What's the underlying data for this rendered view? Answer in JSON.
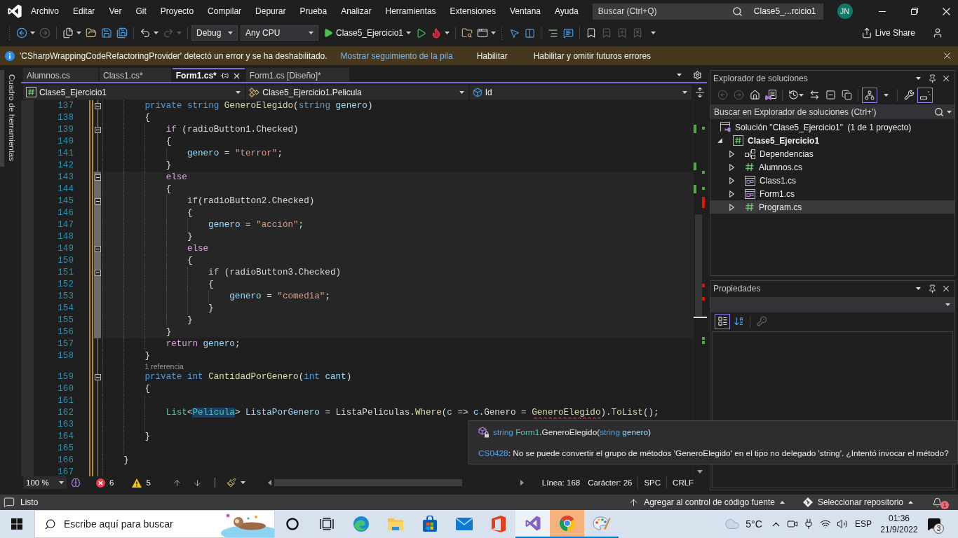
{
  "menu_bar": {
    "items": [
      "Archivo",
      "Editar",
      "Ver",
      "Git",
      "Proyecto",
      "Compilar",
      "Depurar",
      "Prueba",
      "Analizar",
      "Herramientas",
      "Extensiones",
      "Ventana",
      "Ayuda"
    ],
    "search": {
      "placeholder": "Buscar (Ctrl+Q)"
    },
    "solution_name": "Clase5_...rcicio1",
    "account_initials": "JN"
  },
  "toolbar": {
    "navigation": [
      {
        "disabled": false
      },
      {
        "disabled": true
      }
    ],
    "history": [
      {
        "disabled": false
      },
      {
        "disabled": true
      }
    ],
    "configuration": "Debug",
    "platform": "Any CPU",
    "startup_project": "Clase5_Ejercicio1",
    "bookmarks": [
      {
        "disabled": false
      },
      {
        "disabled": true
      },
      {
        "disabled": true
      },
      {
        "disabled": true
      }
    ],
    "live_share": "Live Share"
  },
  "info_bar": {
    "message": "'CSharpWrappingCodeRefactoringProvider' detectó un error y se ha deshabilitado.",
    "link": "Mostrar seguimiento de la pila",
    "actions": [
      "Habilitar",
      "Habilitar y omitir futuros errores"
    ]
  },
  "side_tabs": [
    "Cuadro de herramientas"
  ],
  "editor": {
    "tabs": [
      {
        "label": "Alumnos.cs",
        "selected": false
      },
      {
        "label": "Class1.cs*",
        "selected": false
      },
      {
        "label": "Form1.cs*",
        "selected": true
      },
      {
        "label": "Form1.cs [Diseño]*",
        "selected": false
      }
    ],
    "navigation": [
      "Clase5_Ejercicio1",
      "Clase5_Ejercicio1.Pelicula",
      "Id"
    ],
    "lines": [
      {
        "kind": "code",
        "number": "137",
        "foldable": true,
        "highlighted": false,
        "modified": true,
        "tokens": [
          {
            "text": "        private string ",
            "kind": "keyword"
          },
          {
            "text": "GeneroElegido",
            "kind": "method"
          },
          {
            "text": "(",
            "kind": "plain"
          },
          {
            "text": "string ",
            "kind": "keyword"
          },
          {
            "text": "genero",
            "kind": "variable"
          },
          {
            "text": ")",
            "kind": "plain"
          }
        ]
      },
      {
        "kind": "code",
        "number": "138",
        "foldable": false,
        "highlighted": false,
        "modified": true,
        "tokens": [
          {
            "text": "        {",
            "kind": "plain"
          }
        ]
      },
      {
        "kind": "code",
        "number": "139",
        "foldable": true,
        "highlighted": false,
        "modified": true,
        "tokens": [
          {
            "text": "            if",
            "kind": "control"
          },
          {
            "text": " (radioButton1.Checked)",
            "kind": "plain"
          }
        ]
      },
      {
        "kind": "code",
        "number": "140",
        "foldable": false,
        "highlighted": false,
        "modified": true,
        "tokens": [
          {
            "text": "            {",
            "kind": "plain"
          }
        ]
      },
      {
        "kind": "code",
        "number": "141",
        "foldable": false,
        "highlighted": false,
        "modified": true,
        "tokens": [
          {
            "text": "                genero",
            "kind": "variable"
          },
          {
            "text": " = ",
            "kind": "plain"
          },
          {
            "text": "\"terror\"",
            "kind": "string"
          },
          {
            "text": ";",
            "kind": "plain"
          }
        ]
      },
      {
        "kind": "code",
        "number": "142",
        "foldable": false,
        "highlighted": false,
        "modified": true,
        "tokens": [
          {
            "text": "            }",
            "kind": "plain"
          }
        ]
      },
      {
        "kind": "code",
        "number": "143",
        "foldable": true,
        "highlighted": true,
        "modified": true,
        "tokens": [
          {
            "text": "            else",
            "kind": "control"
          }
        ]
      },
      {
        "kind": "code",
        "number": "144",
        "foldable": false,
        "highlighted": true,
        "modified": true,
        "tokens": [
          {
            "text": "            {",
            "kind": "plain"
          }
        ]
      },
      {
        "kind": "code",
        "number": "145",
        "foldable": true,
        "highlighted": true,
        "modified": true,
        "tokens": [
          {
            "text": "                if",
            "kind": "control"
          },
          {
            "text": "(radioButton2.Checked)",
            "kind": "plain"
          }
        ]
      },
      {
        "kind": "code",
        "number": "146",
        "foldable": false,
        "highlighted": true,
        "modified": true,
        "tokens": [
          {
            "text": "                {",
            "kind": "plain"
          }
        ]
      },
      {
        "kind": "code",
        "number": "147",
        "foldable": false,
        "highlighted": true,
        "modified": true,
        "tokens": [
          {
            "text": "                    genero",
            "kind": "variable"
          },
          {
            "text": " = ",
            "kind": "plain"
          },
          {
            "text": "\"acción\"",
            "kind": "string"
          },
          {
            "text": ";",
            "kind": "plain"
          }
        ]
      },
      {
        "kind": "code",
        "number": "148",
        "foldable": false,
        "highlighted": true,
        "modified": true,
        "tokens": [
          {
            "text": "                }",
            "kind": "plain"
          }
        ]
      },
      {
        "kind": "code",
        "number": "149",
        "foldable": true,
        "highlighted": true,
        "modified": true,
        "tokens": [
          {
            "text": "                else",
            "kind": "control"
          }
        ]
      },
      {
        "kind": "code",
        "number": "150",
        "foldable": false,
        "highlighted": true,
        "modified": true,
        "tokens": [
          {
            "text": "                {",
            "kind": "plain"
          }
        ]
      },
      {
        "kind": "code",
        "number": "151",
        "foldable": true,
        "highlighted": true,
        "modified": true,
        "tokens": [
          {
            "text": "                    if",
            "kind": "control"
          },
          {
            "text": " (radioButton3.Checked)",
            "kind": "plain"
          }
        ]
      },
      {
        "kind": "code",
        "number": "152",
        "foldable": false,
        "highlighted": true,
        "modified": true,
        "tokens": [
          {
            "text": "                    {",
            "kind": "plain"
          }
        ]
      },
      {
        "kind": "code",
        "number": "153",
        "foldable": false,
        "highlighted": true,
        "modified": true,
        "tokens": [
          {
            "text": "                        genero",
            "kind": "variable"
          },
          {
            "text": " = ",
            "kind": "plain"
          },
          {
            "text": "\"comedia\"",
            "kind": "string"
          },
          {
            "text": ";",
            "kind": "plain"
          }
        ]
      },
      {
        "kind": "code",
        "number": "154",
        "foldable": false,
        "highlighted": true,
        "modified": true,
        "tokens": [
          {
            "text": "                    }",
            "kind": "plain"
          }
        ]
      },
      {
        "kind": "code",
        "number": "155",
        "foldable": false,
        "highlighted": true,
        "modified": true,
        "tokens": [
          {
            "text": "                }",
            "kind": "plain"
          }
        ]
      },
      {
        "kind": "code",
        "number": "156",
        "foldable": false,
        "highlighted": true,
        "modified": true,
        "tokens": [
          {
            "text": "            }",
            "kind": "plain"
          }
        ]
      },
      {
        "kind": "code",
        "number": "157",
        "foldable": false,
        "highlighted": false,
        "modified": true,
        "tokens": [
          {
            "text": "            return ",
            "kind": "control"
          },
          {
            "text": "genero",
            "kind": "variable"
          },
          {
            "text": ";",
            "kind": "plain"
          }
        ]
      },
      {
        "kind": "code",
        "number": "158",
        "foldable": false,
        "highlighted": false,
        "modified": true,
        "tokens": [
          {
            "text": "        }",
            "kind": "plain"
          }
        ]
      },
      {
        "kind": "lens",
        "text": "1 referencia",
        "modified": true
      },
      {
        "kind": "code",
        "number": "159",
        "foldable": true,
        "highlighted": false,
        "modified": true,
        "tokens": [
          {
            "text": "        private int ",
            "kind": "keyword"
          },
          {
            "text": "CantidadPorGenero",
            "kind": "method"
          },
          {
            "text": "(",
            "kind": "plain"
          },
          {
            "text": "int ",
            "kind": "keyword"
          },
          {
            "text": "cant",
            "kind": "variable"
          },
          {
            "text": ")",
            "kind": "plain"
          }
        ]
      },
      {
        "kind": "code",
        "number": "160",
        "foldable": false,
        "highlighted": false,
        "modified": true,
        "tokens": [
          {
            "text": "        {",
            "kind": "plain"
          }
        ]
      },
      {
        "kind": "code",
        "number": "161",
        "foldable": false,
        "highlighted": false,
        "modified": true
      },
      {
        "kind": "code",
        "number": "162",
        "foldable": false,
        "highlighted": false,
        "modified": true,
        "tokens": [
          {
            "text": "            List",
            "kind": "type"
          },
          {
            "text": "<",
            "kind": "plain"
          },
          {
            "text": "Pelicula",
            "kind": "type_highlighted"
          },
          {
            "text": "> ",
            "kind": "plain"
          },
          {
            "text": "ListaPorGenero",
            "kind": "variable"
          },
          {
            "text": " = ListaPeliculas.",
            "kind": "plain"
          },
          {
            "text": "Where",
            "kind": "method"
          },
          {
            "text": "(",
            "kind": "plain"
          },
          {
            "text": "c",
            "kind": "variable"
          },
          {
            "text": " => ",
            "kind": "plain"
          },
          {
            "text": "c",
            "kind": "variable"
          },
          {
            "text": ".Genero = ",
            "kind": "plain"
          },
          {
            "text": "GeneroElegido",
            "kind": "method_error"
          },
          {
            "text": ").",
            "kind": "plain"
          },
          {
            "text": "ToList",
            "kind": "method"
          },
          {
            "text": "();",
            "kind": "plain"
          }
        ]
      },
      {
        "kind": "code",
        "number": "163",
        "foldable": false,
        "highlighted": false,
        "modified": true
      },
      {
        "kind": "code",
        "number": "164",
        "foldable": false,
        "highlighted": false,
        "modified": true,
        "tokens": [
          {
            "text": "        }",
            "kind": "plain"
          }
        ]
      },
      {
        "kind": "code",
        "number": "165",
        "foldable": false,
        "highlighted": false,
        "modified": true
      },
      {
        "kind": "code",
        "number": "166",
        "foldable": false,
        "highlighted": false,
        "modified": true,
        "tokens": [
          {
            "text": "    }",
            "kind": "plain"
          }
        ]
      },
      {
        "kind": "code",
        "number": "167",
        "foldable": false,
        "highlighted": false,
        "modified": true
      }
    ],
    "status": {
      "zoom": "100 %",
      "errors": "6",
      "warnings": "5",
      "line": "Línea: 168",
      "column": "Carácter: 26",
      "whitespace": "SPC",
      "line_ending": "CRLF"
    }
  },
  "quick_info": {
    "signature": [
      {
        "text": "string ",
        "kind": "keyword"
      },
      {
        "text": "Form1",
        "kind": "type"
      },
      {
        "text": ".",
        "kind": "plain"
      },
      {
        "text": "GeneroElegido",
        "kind": "method"
      },
      {
        "text": "(",
        "kind": "plain"
      },
      {
        "text": "string ",
        "kind": "keyword"
      },
      {
        "text": "genero",
        "kind": "variable"
      },
      {
        "text": ")",
        "kind": "plain"
      }
    ],
    "error_code": "CS0428",
    "message": ": No se puede convertir el grupo de métodos 'GeneroElegido' en el tipo no delegado 'string'. ¿Intentó invocar el método?"
  },
  "solution_explorer": {
    "title": "Explorador de soluciones",
    "toolbar": {
      "back": {
        "disabled": true
      },
      "forward": {
        "disabled": true
      },
      "tree_view": {
        "selected": true
      },
      "preview": {
        "selected": true
      }
    },
    "search": {
      "placeholder": "Buscar en Explorador de soluciones (Ctrl+')"
    },
    "tree": [
      {
        "kind": "solution",
        "label": "Solución \"Clase5_Ejercicio1\"  (1 de 1 proyecto)",
        "selected": false,
        "children": [
          {
            "kind": "project",
            "label": "Clase5_Ejercicio1",
            "expanded": true,
            "selected": false,
            "children": [
              {
                "kind": "dependencies",
                "label": "Dependencias",
                "expanded": false,
                "selected": false
              },
              {
                "kind": "code_file",
                "label": "Alumnos.cs",
                "expanded": false,
                "selected": false
              },
              {
                "kind": "form_file",
                "label": "Class1.cs",
                "expanded": false,
                "selected": false
              },
              {
                "kind": "form_file",
                "label": "Form1.cs",
                "expanded": false,
                "selected": false
              },
              {
                "kind": "code_file",
                "label": "Program.cs",
                "expanded": false,
                "selected": true
              }
            ]
          }
        ]
      }
    ]
  },
  "properties": {
    "title": "Propiedades",
    "toolbar": {
      "categorized": {
        "selected": true
      },
      "alphabetical": {
        "selected": false
      },
      "property_pages": {
        "disabled": true
      }
    }
  },
  "status_bar": {
    "message": "Listo",
    "source_control": "Agregar al control de código fuente",
    "repository": "Seleccionar repositorio",
    "notifications": "1"
  },
  "taskbar": {
    "search": {
      "placeholder": "Escribe aquí para buscar"
    },
    "apps": [
      {
        "running": false,
        "selected": false,
        "flashing": false
      },
      {
        "running": false,
        "selected": false,
        "flashing": false
      },
      {
        "running": false,
        "selected": false,
        "flashing": false
      },
      {
        "running": false,
        "selected": false,
        "flashing": false
      },
      {
        "running": false,
        "selected": false,
        "flashing": false
      },
      {
        "running": true,
        "selected": true,
        "flashing": false
      },
      {
        "running": true,
        "selected": false,
        "flashing": true
      },
      {
        "running": true,
        "selected": false,
        "flashing": false
      }
    ],
    "weather": "5°C",
    "language": "ESP",
    "time": "01:36",
    "date": "21/9/2022",
    "notifications": "3"
  }
}
